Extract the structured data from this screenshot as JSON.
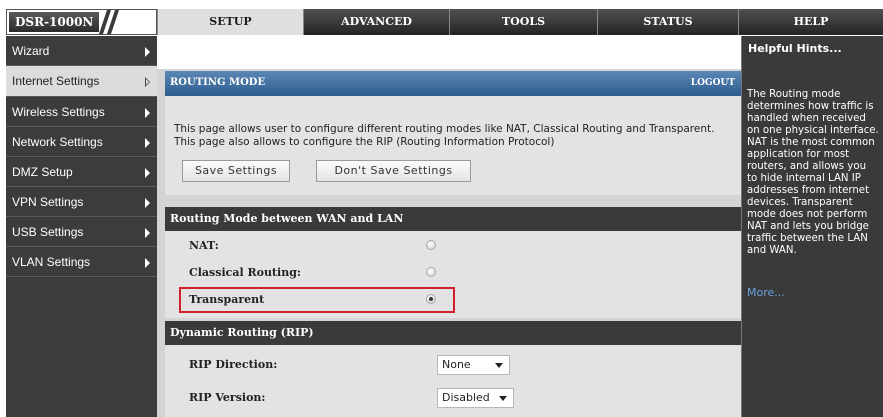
{
  "brand": {
    "model": "DSR-1000N"
  },
  "topnav": {
    "tabs": [
      "SETUP",
      "ADVANCED",
      "TOOLS",
      "STATUS",
      "HELP"
    ],
    "active": "SETUP"
  },
  "sidebar": {
    "items": [
      {
        "label": "Wizard"
      },
      {
        "label": "Internet Settings"
      },
      {
        "label": "Wireless Settings"
      },
      {
        "label": "Network Settings"
      },
      {
        "label": "DMZ Setup"
      },
      {
        "label": "VPN Settings"
      },
      {
        "label": "USB Settings"
      },
      {
        "label": "VLAN Settings"
      }
    ],
    "active_index": 1
  },
  "routing_mode": {
    "title": "ROUTING MODE",
    "logout": "LOGOUT",
    "description_line1": "This page allows user to configure different routing modes like NAT, Classical Routing and Transparent.",
    "description_line2": "This page also allows to configure the RIP (Routing Information Protocol)",
    "save_label": "Save Settings",
    "dont_save_label": "Don't Save Settings"
  },
  "wan_lan": {
    "header": "Routing Mode between WAN and LAN",
    "options": [
      {
        "label": "NAT:",
        "selected": false
      },
      {
        "label": "Classical Routing:",
        "selected": false
      },
      {
        "label": "Transparent",
        "selected": true
      }
    ]
  },
  "rip": {
    "header": "Dynamic Routing (RIP)",
    "direction_label": "RIP Direction:",
    "direction_value": "None",
    "version_label": "RIP Version:",
    "version_value": "Disabled"
  },
  "help": {
    "title": "Helpful Hints...",
    "text": "The Routing mode\ndetermines how traffic is\nhandled when received\non one physical interface.\nNAT is the most common\napplication for most\nrouters, and allows you\nto hide internal LAN IP\naddresses from internet\ndevices. Transparent\nmode does not perform\nNAT and lets you bridge\ntraffic between the LAN\nand WAN.",
    "more": "More..."
  },
  "colors": {
    "accent_header": "#2c5d8f",
    "highlight": "#d0202a",
    "help_link": "#6aa2de"
  }
}
